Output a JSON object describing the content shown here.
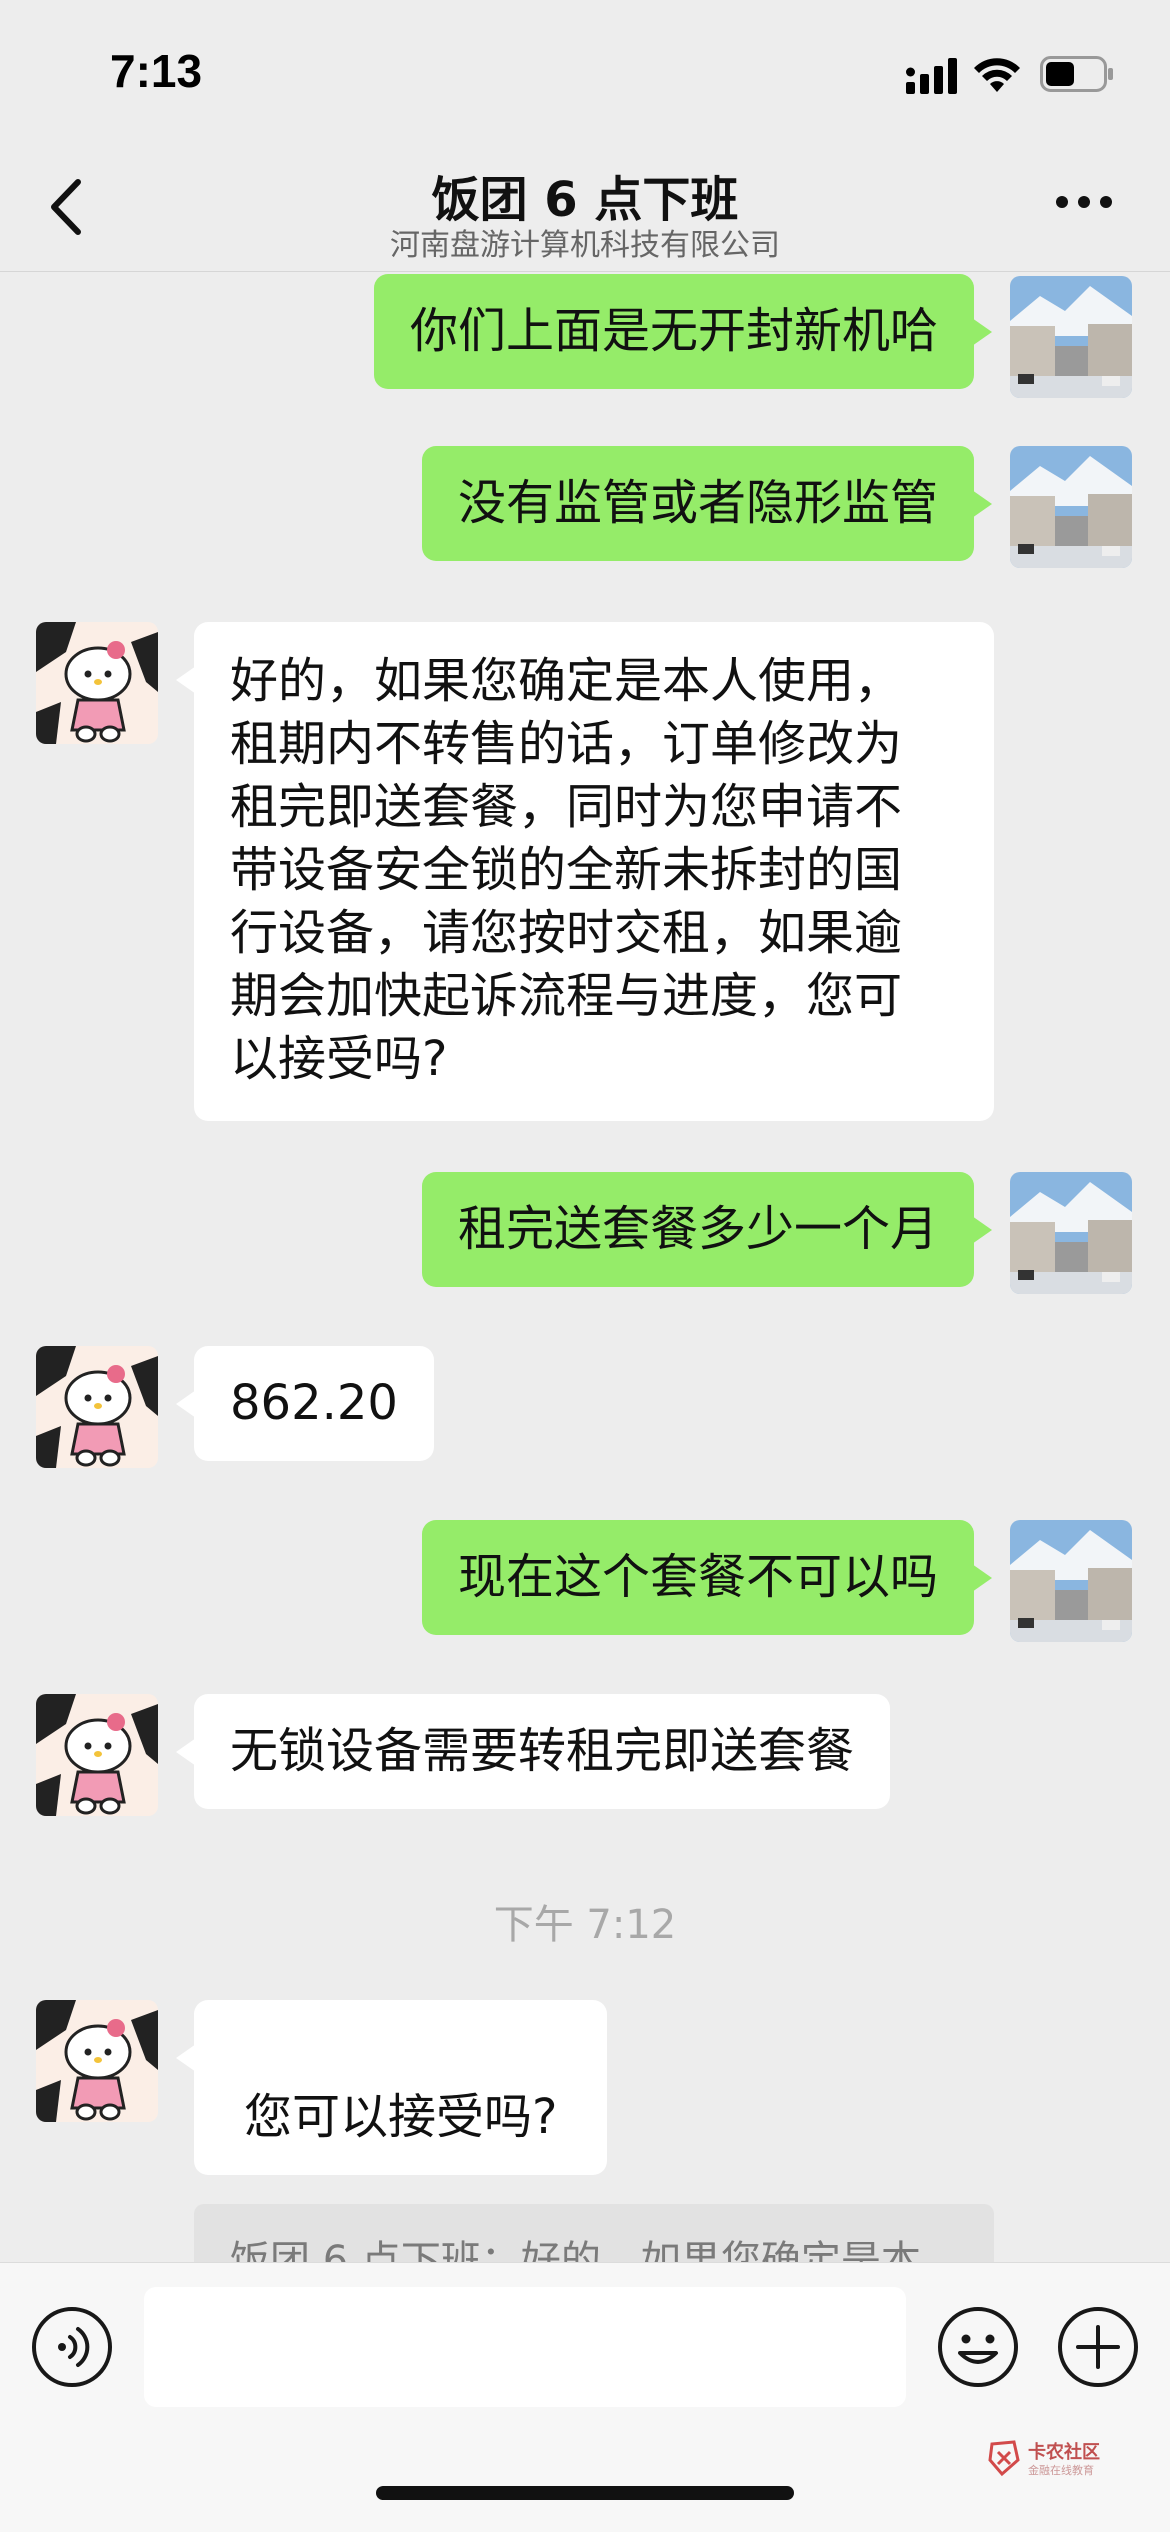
{
  "status_bar": {
    "time": "7:13",
    "battery_level": 0.5
  },
  "header": {
    "back_icon": "chevron-left-icon",
    "title": "饭团 6 点下班",
    "subtitle": "河南盘游计算机科技有限公司",
    "more_icon": "more-dots-icon"
  },
  "messages": [
    {
      "sender": "me",
      "text": "你们上面是无开封新机哈"
    },
    {
      "sender": "me",
      "text": "没有监管或者隐形监管"
    },
    {
      "sender": "them",
      "lines": [
        "好的，如果您确定是本人使用，",
        "租期内不转售的话，订单修改为",
        "租完即送套餐，同时为您申请不",
        "带设备安全锁的全新未拆封的国",
        "行设备，请您按时交租，如果逾",
        "期会加快起诉流程与进度，您可",
        "以接受吗?"
      ]
    },
    {
      "sender": "me",
      "text": "租完送套餐多少一个月"
    },
    {
      "sender": "them",
      "text": "862.20"
    },
    {
      "sender": "me",
      "text": "现在这个套餐不可以吗"
    },
    {
      "sender": "them",
      "text": "无锁设备需要转租完即送套餐"
    },
    {
      "sender": "them",
      "text": "您可以接受吗?"
    }
  ],
  "timestamp": "下午 7:12",
  "quoted_reply": "饭团 6 点下班：好的，如果您确定是本",
  "input_bar": {
    "voice_icon": "voice-icon",
    "input_value": "",
    "emoji_icon": "emoji-icon",
    "plus_icon": "plus-icon"
  },
  "watermark": {
    "title": "卡农社区",
    "subtitle": "金融在线教育"
  }
}
